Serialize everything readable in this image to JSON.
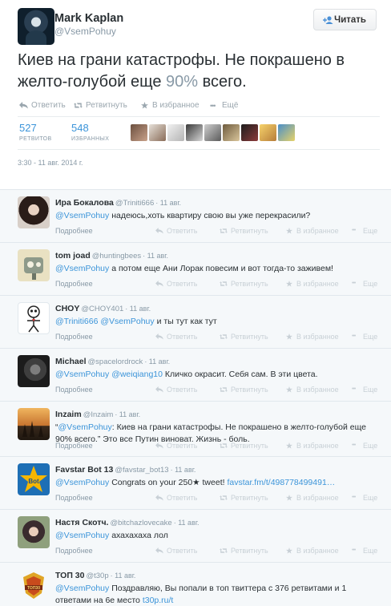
{
  "tweet": {
    "author_name": "Mark Kaplan",
    "author_handle": "@VsemPohuy",
    "follow_label": "Читать",
    "text_main": "Киев на грани катастрофы. Не покрашено в желто-голубой еще ",
    "text_pct": "90%",
    "text_end": " всего.",
    "actions": {
      "reply": "Ответить",
      "retweet": "Ретвитнуть",
      "favorite": "В избранное",
      "more": "Ещё"
    },
    "retweets_count": "527",
    "retweets_label": "РЕТВИТОВ",
    "favorites_count": "548",
    "favorites_label": "ИЗБРАННЫХ",
    "timestamp": "3:30 - 11 авг. 2014 г."
  },
  "reply_actions": {
    "details": "Подробнее",
    "reply": "Ответить",
    "retweet": "Ретвитнуть",
    "favorite": "В избранное",
    "more": "Еще"
  },
  "replies": [
    {
      "name": "Ира Бокалова",
      "handle": "@Triniti666",
      "date": "· 11 авг.",
      "mention": "@VsemPohuy",
      "text": " надеюсь,хоть квартиру свою вы уже перекрасили?",
      "avatar_icon": "woman-avatar-icon"
    },
    {
      "name": "tom joad",
      "handle": "@huntingbees",
      "date": "· 11 авг.",
      "mention": "@VsemPohuy",
      "text": " а потом еще Ани Лорак повесим и вот тогда-то заживем!",
      "avatar_icon": "robot-avatar-icon"
    },
    {
      "name": "CHOY",
      "handle": "@CHOY401",
      "date": "· 11 авг.",
      "mention": "@Triniti666 @VsemPohuy",
      "text": " и ты тут как тут",
      "avatar_icon": "stickman-avatar-icon"
    },
    {
      "name": "Michael",
      "handle": "@spacelordrock",
      "date": "· 11 авг.",
      "mention": "@VsemPohuy @weiqiang10",
      "text": " Кличко окрасит. Себя сам. В эти цвета.",
      "avatar_icon": "man-avatar-icon"
    },
    {
      "name": "Inzaim",
      "handle": "@Inzaim",
      "date": "· 11 авг.",
      "quote_start": "“",
      "mention": "@VsemPohuy",
      "text": ": Киев на грани катастрофы. Не покрашено в желто-голубой еще 90% всего.” Это все Путин виноват. Жизнь - боль.",
      "avatar_icon": "sunset-avatar-icon"
    },
    {
      "name": "Favstar Bot 13",
      "handle": "@favstar_bot13",
      "date": "· 11 авг.",
      "mention": "@VsemPohuy",
      "text": " Congrats on your 250★ tweet! ",
      "link": "favstar.fm/t/498778499491…",
      "avatar_icon": "star-bot-icon"
    },
    {
      "name": "Настя Скотч.",
      "handle": "@bitchazlovecake",
      "date": "· 11 авг.",
      "mention": "@VsemPohuy",
      "text": " ахахахаха лол",
      "avatar_icon": "girl-avatar-icon"
    },
    {
      "name": "ТОП 30",
      "handle": "@t30p",
      "date": "· 11 авг.",
      "mention": "@VsemPohuy",
      "text": " Поздравляю, Вы попали в топ твиттера с 376 ретвитами и 1 ответами на 6е место ",
      "link": "t30p.ru/t",
      "avatar_icon": "top30-badge-icon"
    }
  ],
  "colors": {
    "link": "#3b94d9",
    "muted": "#8899a6",
    "background_replies": "#f5f8fa",
    "star_bot": "#f6b600"
  }
}
